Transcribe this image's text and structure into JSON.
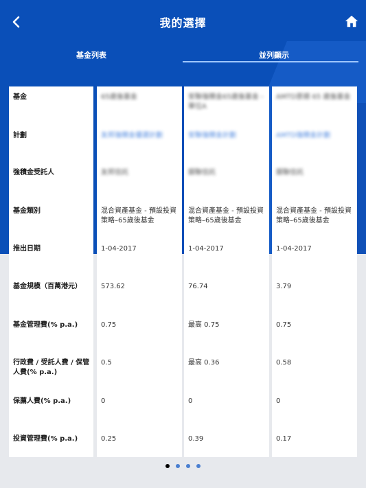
{
  "header": {
    "title": "我的選擇",
    "back_icon": "chevron-left-icon",
    "home_icon": "home-icon"
  },
  "tabs": [
    {
      "label": "基金列表",
      "active": false
    },
    {
      "label": "並列顯示",
      "active": true
    }
  ],
  "row_labels": [
    "基金",
    "計劃",
    "強積金受託人",
    "基金類別",
    "推出日期",
    "基金規模（百萬港元）",
    "基金管理費(% p.a.)",
    "行政費 / 受託人費 / 保管人費(% p.a.)",
    "保薦人費(% p.a.)",
    "投資管理費(% p.a.)"
  ],
  "columns": [
    {
      "fund": "65歲後基金",
      "scheme": "友邦強積金優選計劃",
      "trustee": "友邦信託",
      "category": "混合資產基金 - 預設投資策略–65歲後基金",
      "launch_date": "1-04-2017",
      "fund_size": "573.62",
      "mgmt_fee": "0.75",
      "admin_fee": "0.5",
      "sponsor_fee": "0",
      "investment_fee": "0.25"
    },
    {
      "fund": "安聯強積金65歲後基金 - 單位A",
      "scheme": "安聯強積金計劃",
      "trustee": "銀聯信託",
      "category": "混合資產基金 - 預設投資策略–65歲後基金",
      "launch_date": "1-04-2017",
      "fund_size": "76.74",
      "mgmt_fee": "最高 0.75",
      "admin_fee": "最高 0.36",
      "sponsor_fee": "0",
      "investment_fee": "0.39"
    },
    {
      "fund": "AMTD景順 65 歲後基金",
      "scheme": "AMTD強積金計劃",
      "trustee": "銀聯信託",
      "category": "混合資產基金 - 預設投資策略–65歲後基金",
      "launch_date": "1-04-2017",
      "fund_size": "3.79",
      "mgmt_fee": "0.75",
      "admin_fee": "0.58",
      "sponsor_fee": "0",
      "investment_fee": "0.17"
    }
  ],
  "pagination": {
    "total": 4,
    "active_index": 0
  },
  "colors": {
    "brand_blue": "#0a4fb8",
    "link_blue": "#2f73d9",
    "bg": "#e7e9ed"
  }
}
